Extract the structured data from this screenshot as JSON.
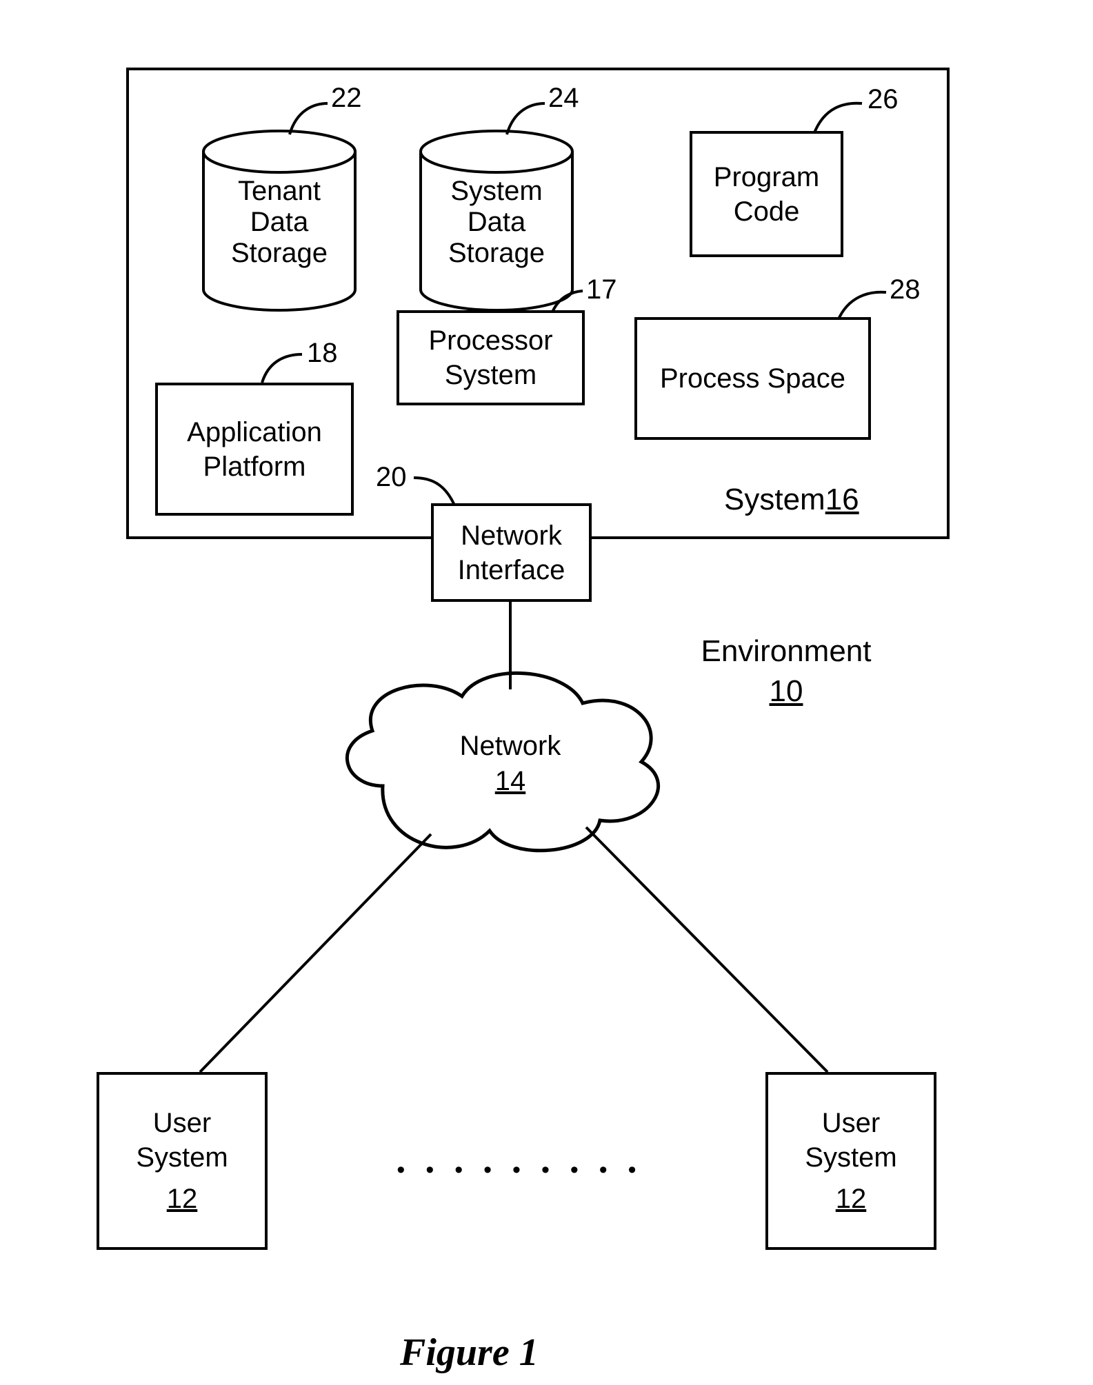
{
  "refs": {
    "tenant_storage": "22",
    "system_storage": "24",
    "program_code": "26",
    "processor": "17",
    "process_space": "28",
    "app_platform": "18",
    "net_interface": "20",
    "system": "16",
    "environment": "10",
    "network": "14",
    "user_system": "12"
  },
  "labels": {
    "tenant_storage_l1": "Tenant",
    "tenant_storage_l2": "Data",
    "tenant_storage_l3": "Storage",
    "system_storage_l1": "System",
    "system_storage_l2": "Data",
    "system_storage_l3": "Storage",
    "program_code_l1": "Program",
    "program_code_l2": "Code",
    "processor_l1": "Processor",
    "processor_l2": "System",
    "process_space": "Process Space",
    "app_platform_l1": "Application",
    "app_platform_l2": "Platform",
    "net_interface_l1": "Network",
    "net_interface_l2": "Interface",
    "system_prefix": "System",
    "environment": "Environment",
    "network": "Network",
    "user_system_l1": "User",
    "user_system_l2": "System"
  },
  "figure_label": "Figure 1"
}
